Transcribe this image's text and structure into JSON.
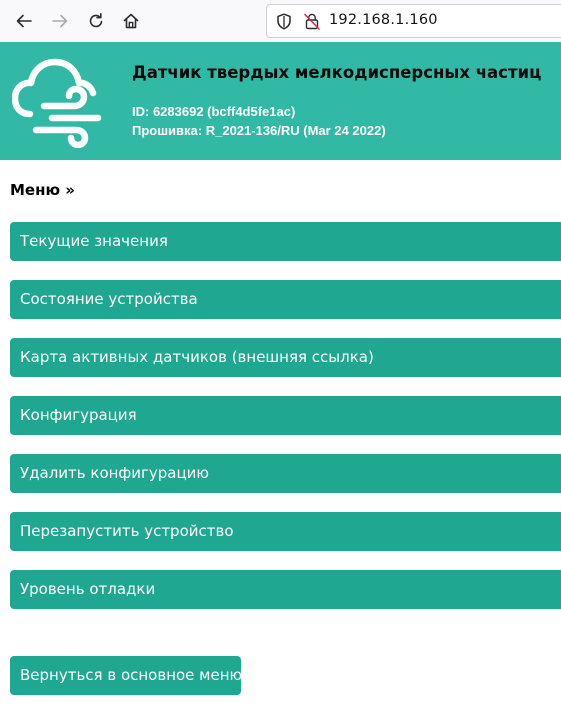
{
  "browser": {
    "url": "192.168.1.160",
    "icons": {
      "back": "arrow-left-icon",
      "forward": "arrow-right-icon",
      "reload": "reload-icon",
      "home": "home-icon",
      "shield": "shield-icon",
      "insecure": "insecure-lock-icon"
    }
  },
  "header": {
    "title": "Датчик твердых мелкодисперсных частиц",
    "id_line": "ID: 6283692 (bcff4d5fe1ac)",
    "firmware_line": "Прошивка: R_2021-136/RU (Mar 24 2022)",
    "logo_icon": "cloud-wind-icon"
  },
  "menu": {
    "title": "Меню »",
    "items": [
      {
        "label": "Текущие значения"
      },
      {
        "label": "Состояние устройства"
      },
      {
        "label": "Карта активных датчиков (внешняя ссылка)"
      },
      {
        "label": "Конфигурация"
      },
      {
        "label": "Удалить конфигурацию"
      },
      {
        "label": "Перезапустить устройство"
      },
      {
        "label": "Уровень отладки"
      }
    ],
    "back_label": "Вернуться в основное меню"
  },
  "colors": {
    "header_bg": "#32b9a6",
    "button_bg": "#20a792",
    "toolbar_bg": "#f9f9fb"
  }
}
